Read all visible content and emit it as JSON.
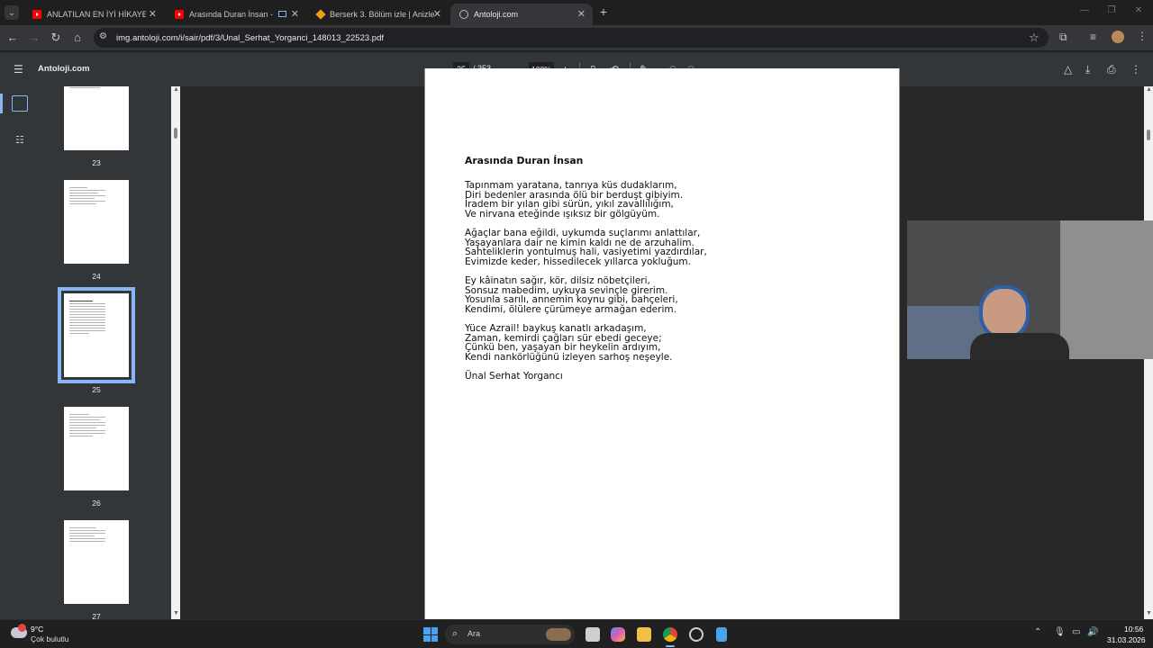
{
  "browser": {
    "tabs": [
      {
        "title": "ANLATILAN EN İYİ HİKAYELERDE",
        "favicon": "youtube-icon",
        "active": false
      },
      {
        "title": "Arasında Duran İnsan - You",
        "favicon": "youtube-icon",
        "active": false
      },
      {
        "title": "Berserk 3. Bölüm izle | Anizle",
        "favicon": "anizle-icon",
        "active": false
      },
      {
        "title": "Antoloji.com",
        "favicon": "globe-icon",
        "active": true
      }
    ],
    "url": "img.antoloji.com/i/sair/pdf/3/Unal_Serhat_Yorganci_148013_22523.pdf"
  },
  "pdf": {
    "doc_title": "Antoloji.com",
    "current_page": "25",
    "total_pages": "/ 353",
    "zoom": "100%",
    "thumbnails": [
      {
        "label": "23",
        "selected": false
      },
      {
        "label": "24",
        "selected": false
      },
      {
        "label": "25",
        "selected": true
      },
      {
        "label": "26",
        "selected": false
      },
      {
        "label": "27",
        "selected": false
      }
    ]
  },
  "poem": {
    "title": "Arasında Duran İnsan",
    "stanzas": [
      [
        "Tapınmam yaratana, tanrıya küs dudaklarım,",
        "Diri bedenler arasında ölü bir berduşt gibiyim.",
        "İradem bir yılan gibi sürün, yıkıl zavallılığım,",
        "Ve nirvana eteğinde ışıksız bir gölgüyüm."
      ],
      [
        "Ağaçlar bana eğildi, uykumda suçlarımı anlattılar,",
        "Yaşayanlara dair ne kimin kaldı ne de arzuhalim.",
        "Sahteliklerin yontulmuş hali, vasiyetimi yazdırdılar,",
        "Evimizde keder, hissedilecek yıllarca yokluğum."
      ],
      [
        "Ey kâinatın sağır, kör, dilsiz nöbetçileri,",
        "Sonsuz mabedim, uykuya sevinçle girerim.",
        "Yosunla sarılı, annemin koynu gibi, bahçeleri,",
        "Kendimi, ölülere çürümeye armağan ederim."
      ],
      [
        "Yüce Azrail! baykuş kanatlı arkadaşım,",
        "Zaman, kemirdi çağları sür ebedi geceye;",
        "Çünkü ben, yaşayan bir heykelin ardıyım,",
        "Kendi nankörlüğünü izleyen sarhoş neşeyle."
      ]
    ],
    "author": "Ünal Serhat Yorgancı"
  },
  "taskbar": {
    "weather_temp": "9°C",
    "weather_desc": "Çok bulutlu",
    "search_placeholder": "Ara",
    "time": "10:56",
    "date": "31.03.2026"
  },
  "colors": {
    "accent": "#8ab4f8",
    "tab_bar": "#1f1f1f",
    "pdf_toolbar": "#323639",
    "viewer_bg": "#282828"
  }
}
